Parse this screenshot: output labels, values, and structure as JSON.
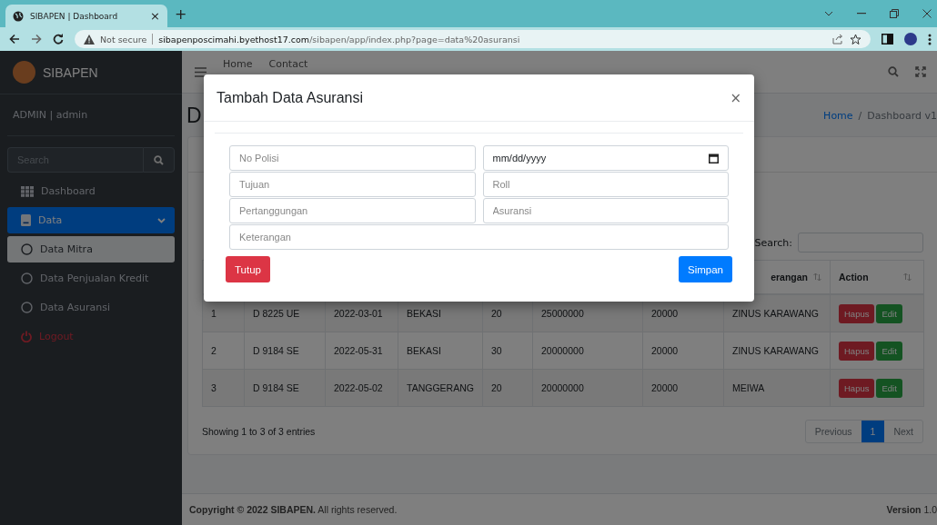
{
  "browser": {
    "tab_title": "SIBAPEN | Dashboard",
    "tab_close": "×",
    "new_tab": "+",
    "security": "Not secure",
    "url_host": "sibapenposcimahi.byethost17.com",
    "url_path": "/sibapen/app/index.php?page=data%20asuransi"
  },
  "sidebar": {
    "brand": "SIBAPEN",
    "user": "ADMIN | admin",
    "search_placeholder": "Search",
    "items": [
      {
        "label": "Dashboard",
        "kind": "dashboard",
        "selected": false
      },
      {
        "label": "Data",
        "kind": "data",
        "selected": true,
        "expanded": true,
        "children": [
          {
            "label": "Data Mitra",
            "selected": true
          },
          {
            "label": "Data Penjualan Kredit",
            "selected": false
          },
          {
            "label": "Data Asuransi",
            "selected": false
          }
        ]
      },
      {
        "label": "Logout",
        "kind": "logout",
        "selected": false
      }
    ]
  },
  "navbar": {
    "links": [
      "Home",
      "Contact"
    ]
  },
  "content": {
    "title": "D",
    "breadcrumb_separator": "/",
    "breadcrumb": [
      {
        "label": "Home",
        "link": true
      },
      {
        "label": "Dashboard v1",
        "link": false
      }
    ]
  },
  "table": {
    "search_label": "Search:",
    "columns": [
      {},
      {},
      {},
      {},
      {},
      {},
      {},
      {
        "label": "erangan"
      },
      {
        "label": "Action"
      }
    ],
    "rows": [
      {
        "cells": [
          "1",
          "D 8225 UE",
          "2022-03-01",
          "BEKASI",
          "20",
          "25000000",
          "20000",
          "ZINUS KARAWANG"
        ],
        "actions": [
          "Hapus",
          "Edit"
        ]
      },
      {
        "cells": [
          "2",
          "D 9184 SE",
          "2022-05-31",
          "BEKASI",
          "30",
          "20000000",
          "20000",
          "ZINUS KARAWANG"
        ],
        "actions": [
          "Hapus",
          "Edit"
        ]
      },
      {
        "cells": [
          "3",
          "D 9184 SE",
          "2022-05-02",
          "TANGGERANG",
          "20",
          "20000000",
          "20000",
          "MEIWA"
        ],
        "actions": [
          "Hapus",
          "Edit"
        ]
      }
    ],
    "info": "Showing 1 to 3 of 3 entries",
    "pagination": [
      {
        "label": "Previous",
        "selected": false
      },
      {
        "label": "1",
        "selected": true
      },
      {
        "label": "Next",
        "selected": false
      }
    ]
  },
  "modal": {
    "title": "Tambah Data Asuransi",
    "close": "×",
    "fields": [
      {
        "kind": "text",
        "placeholder": "No Polisi"
      },
      {
        "kind": "date",
        "placeholder": "mm/dd/yyyy"
      },
      {
        "kind": "text",
        "placeholder": "Tujuan"
      },
      {
        "kind": "text",
        "placeholder": "Roll"
      },
      {
        "kind": "text",
        "placeholder": "Pertanggungan"
      },
      {
        "kind": "text",
        "placeholder": "Asuransi"
      },
      {
        "kind": "wide",
        "placeholder": "Keterangan"
      }
    ],
    "buttons": [
      {
        "label": "Tutup",
        "kind": "danger"
      },
      {
        "label": "Simpan",
        "kind": "primary"
      }
    ]
  },
  "footer": {
    "copyright": "**Copyright © 2022 SIBAPEN.** All rights reserved.",
    "version": "**Version** 1.0"
  }
}
